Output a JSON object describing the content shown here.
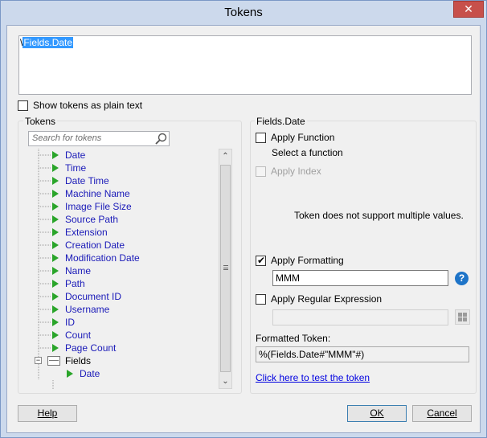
{
  "window": {
    "title": "Tokens",
    "close_glyph": "✕"
  },
  "editor": {
    "prefix": "\\",
    "selected_text": "Fields.Date"
  },
  "show_plain": {
    "label": "Show tokens as plain text",
    "checked": false
  },
  "tokens_group": {
    "title": "Tokens",
    "search_placeholder": "Search for tokens",
    "items": [
      {
        "label": "Date"
      },
      {
        "label": "Time"
      },
      {
        "label": "Date Time"
      },
      {
        "label": "Machine Name"
      },
      {
        "label": "Image File Size"
      },
      {
        "label": "Source Path"
      },
      {
        "label": "Extension"
      },
      {
        "label": "Creation Date"
      },
      {
        "label": "Modification Date"
      },
      {
        "label": "Name"
      },
      {
        "label": "Path"
      },
      {
        "label": "Document ID"
      },
      {
        "label": "Username"
      },
      {
        "label": "ID"
      },
      {
        "label": "Count"
      },
      {
        "label": "Page Count"
      }
    ],
    "fields_node": {
      "label": "Fields",
      "child": "Date"
    }
  },
  "details_group": {
    "title": "Fields.Date",
    "apply_function": {
      "label": "Apply Function",
      "checked": false,
      "sub_label": "Select a function"
    },
    "apply_index": {
      "label": "Apply Index",
      "checked": false,
      "disabled": true
    },
    "multi_note": "Token does not support multiple values.",
    "apply_formatting": {
      "label": "Apply Formatting",
      "checked": true,
      "value": "MMM"
    },
    "apply_regex": {
      "label": "Apply Regular Expression",
      "checked": false,
      "value": ""
    },
    "formatted_label": "Formatted Token:",
    "formatted_value": "%(Fields.Date#\"MMM\"#)",
    "test_link": "Click here to test the token"
  },
  "buttons": {
    "help": "Help",
    "ok": "OK",
    "cancel": "Cancel"
  },
  "colors": {
    "accent": "#1e74c8",
    "token_text": "#1a1ab8",
    "token_arrow": "#2aa52a"
  }
}
